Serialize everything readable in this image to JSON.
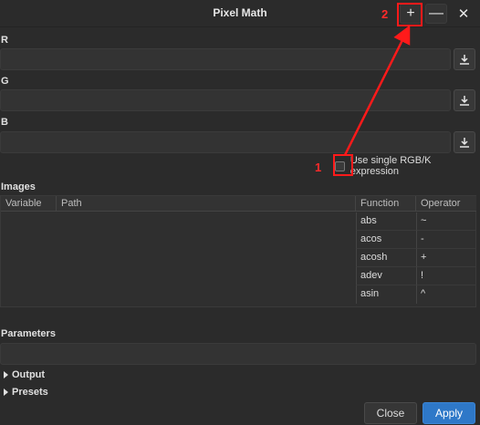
{
  "window": {
    "title": "Pixel Math",
    "close_glyph": "✕"
  },
  "titlebar_buttons": {
    "plus": "+",
    "minus": "—"
  },
  "expressions": {
    "r_label": "R",
    "g_label": "G",
    "b_label": "B",
    "r_value": "",
    "g_value": "",
    "b_value": ""
  },
  "single_rgbk": {
    "label": "Use single RGB/K expression",
    "checked": false
  },
  "images": {
    "section_label": "Images",
    "columns": [
      "Variable",
      "Path",
      "Function",
      "Operator"
    ],
    "functions": [
      "abs",
      "acos",
      "acosh",
      "adev",
      "asin"
    ],
    "operators": [
      "~",
      "-",
      "+",
      "!",
      "^"
    ]
  },
  "parameters": {
    "section_label": "Parameters",
    "value": ""
  },
  "collapsibles": {
    "output": "Output",
    "presets": "Presets"
  },
  "footer": {
    "close": "Close",
    "apply": "Apply"
  },
  "annotations": {
    "step1": "1",
    "step2": "2",
    "color": "#ff1a1a"
  },
  "icons": {
    "download": "download-icon",
    "expand": "triangle-right-icon"
  }
}
